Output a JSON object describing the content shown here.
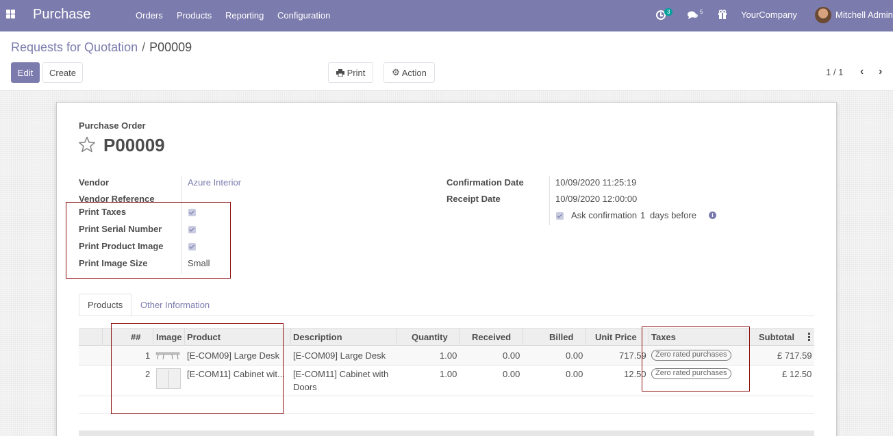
{
  "navbar": {
    "app_title": "Purchase",
    "menus": [
      "Orders",
      "Products",
      "Reporting",
      "Configuration"
    ],
    "activity_count": "3",
    "messages_count": "5",
    "company": "YourCompany",
    "user": "Mitchell Admin"
  },
  "breadcrumb": {
    "parent": "Requests for Quotation",
    "separator": "/",
    "current": "P00009"
  },
  "buttons": {
    "edit": "Edit",
    "create": "Create",
    "print": "Print",
    "action": "Action"
  },
  "pager": {
    "value": "1 / 1"
  },
  "form": {
    "doc_type": "Purchase Order",
    "name": "P00009",
    "left_fields": [
      {
        "label": "Vendor",
        "value": "Azure Interior"
      },
      {
        "label": "Vendor Reference",
        "value": ""
      },
      {
        "label": "Print Taxes",
        "value": true
      },
      {
        "label": "Print Serial Number",
        "value": true
      },
      {
        "label": "Print Product Image",
        "value": true
      },
      {
        "label": "Print Image Size",
        "value": "Small"
      }
    ],
    "right_fields": [
      {
        "label": "Confirmation Date",
        "value": "10/09/2020 11:25:19"
      },
      {
        "label": "Receipt Date",
        "value": "10/09/2020 12:00:00"
      }
    ],
    "ask_confirmation": {
      "checked": true,
      "prefix": "Ask confirmation",
      "days": "1",
      "suffix": "days before"
    }
  },
  "tabs": [
    {
      "label": "Products",
      "active": true
    },
    {
      "label": "Other Information",
      "active": false
    }
  ],
  "table": {
    "headers": [
      "##",
      "Image",
      "Product",
      "Description",
      "Quantity",
      "Received",
      "Billed",
      "Unit Price",
      "Taxes",
      "Subtotal"
    ],
    "rows": [
      {
        "seq": "1",
        "image": "large-desk",
        "product": "[E-COM09] Large Desk",
        "description": "[E-COM09] Large Desk",
        "quantity": "1.00",
        "received": "0.00",
        "billed": "0.00",
        "unit_price": "717.59",
        "taxes": "Zero rated purchases",
        "subtotal": "£ 717.59"
      },
      {
        "seq": "2",
        "image": "cabinet-with-doors",
        "product": "[E-COM11] Cabinet wit...",
        "description_line1": "[E-COM11] Cabinet with",
        "description_line2": "Doors",
        "quantity": "1.00",
        "received": "0.00",
        "billed": "0.00",
        "unit_price": "12.50",
        "taxes": "Zero rated purchases",
        "subtotal": "£ 12.50"
      }
    ]
  },
  "colors": {
    "brand": "#7c7bad",
    "highlight_box": "#8b0a0a"
  },
  "icons": [
    "apps-grid-icon",
    "activity-clock-icon",
    "messages-icon",
    "gift-icon",
    "print-icon",
    "gear-icon",
    "star-icon",
    "info-icon",
    "chevron-left-icon",
    "chevron-right-icon",
    "column-options-icon"
  ]
}
